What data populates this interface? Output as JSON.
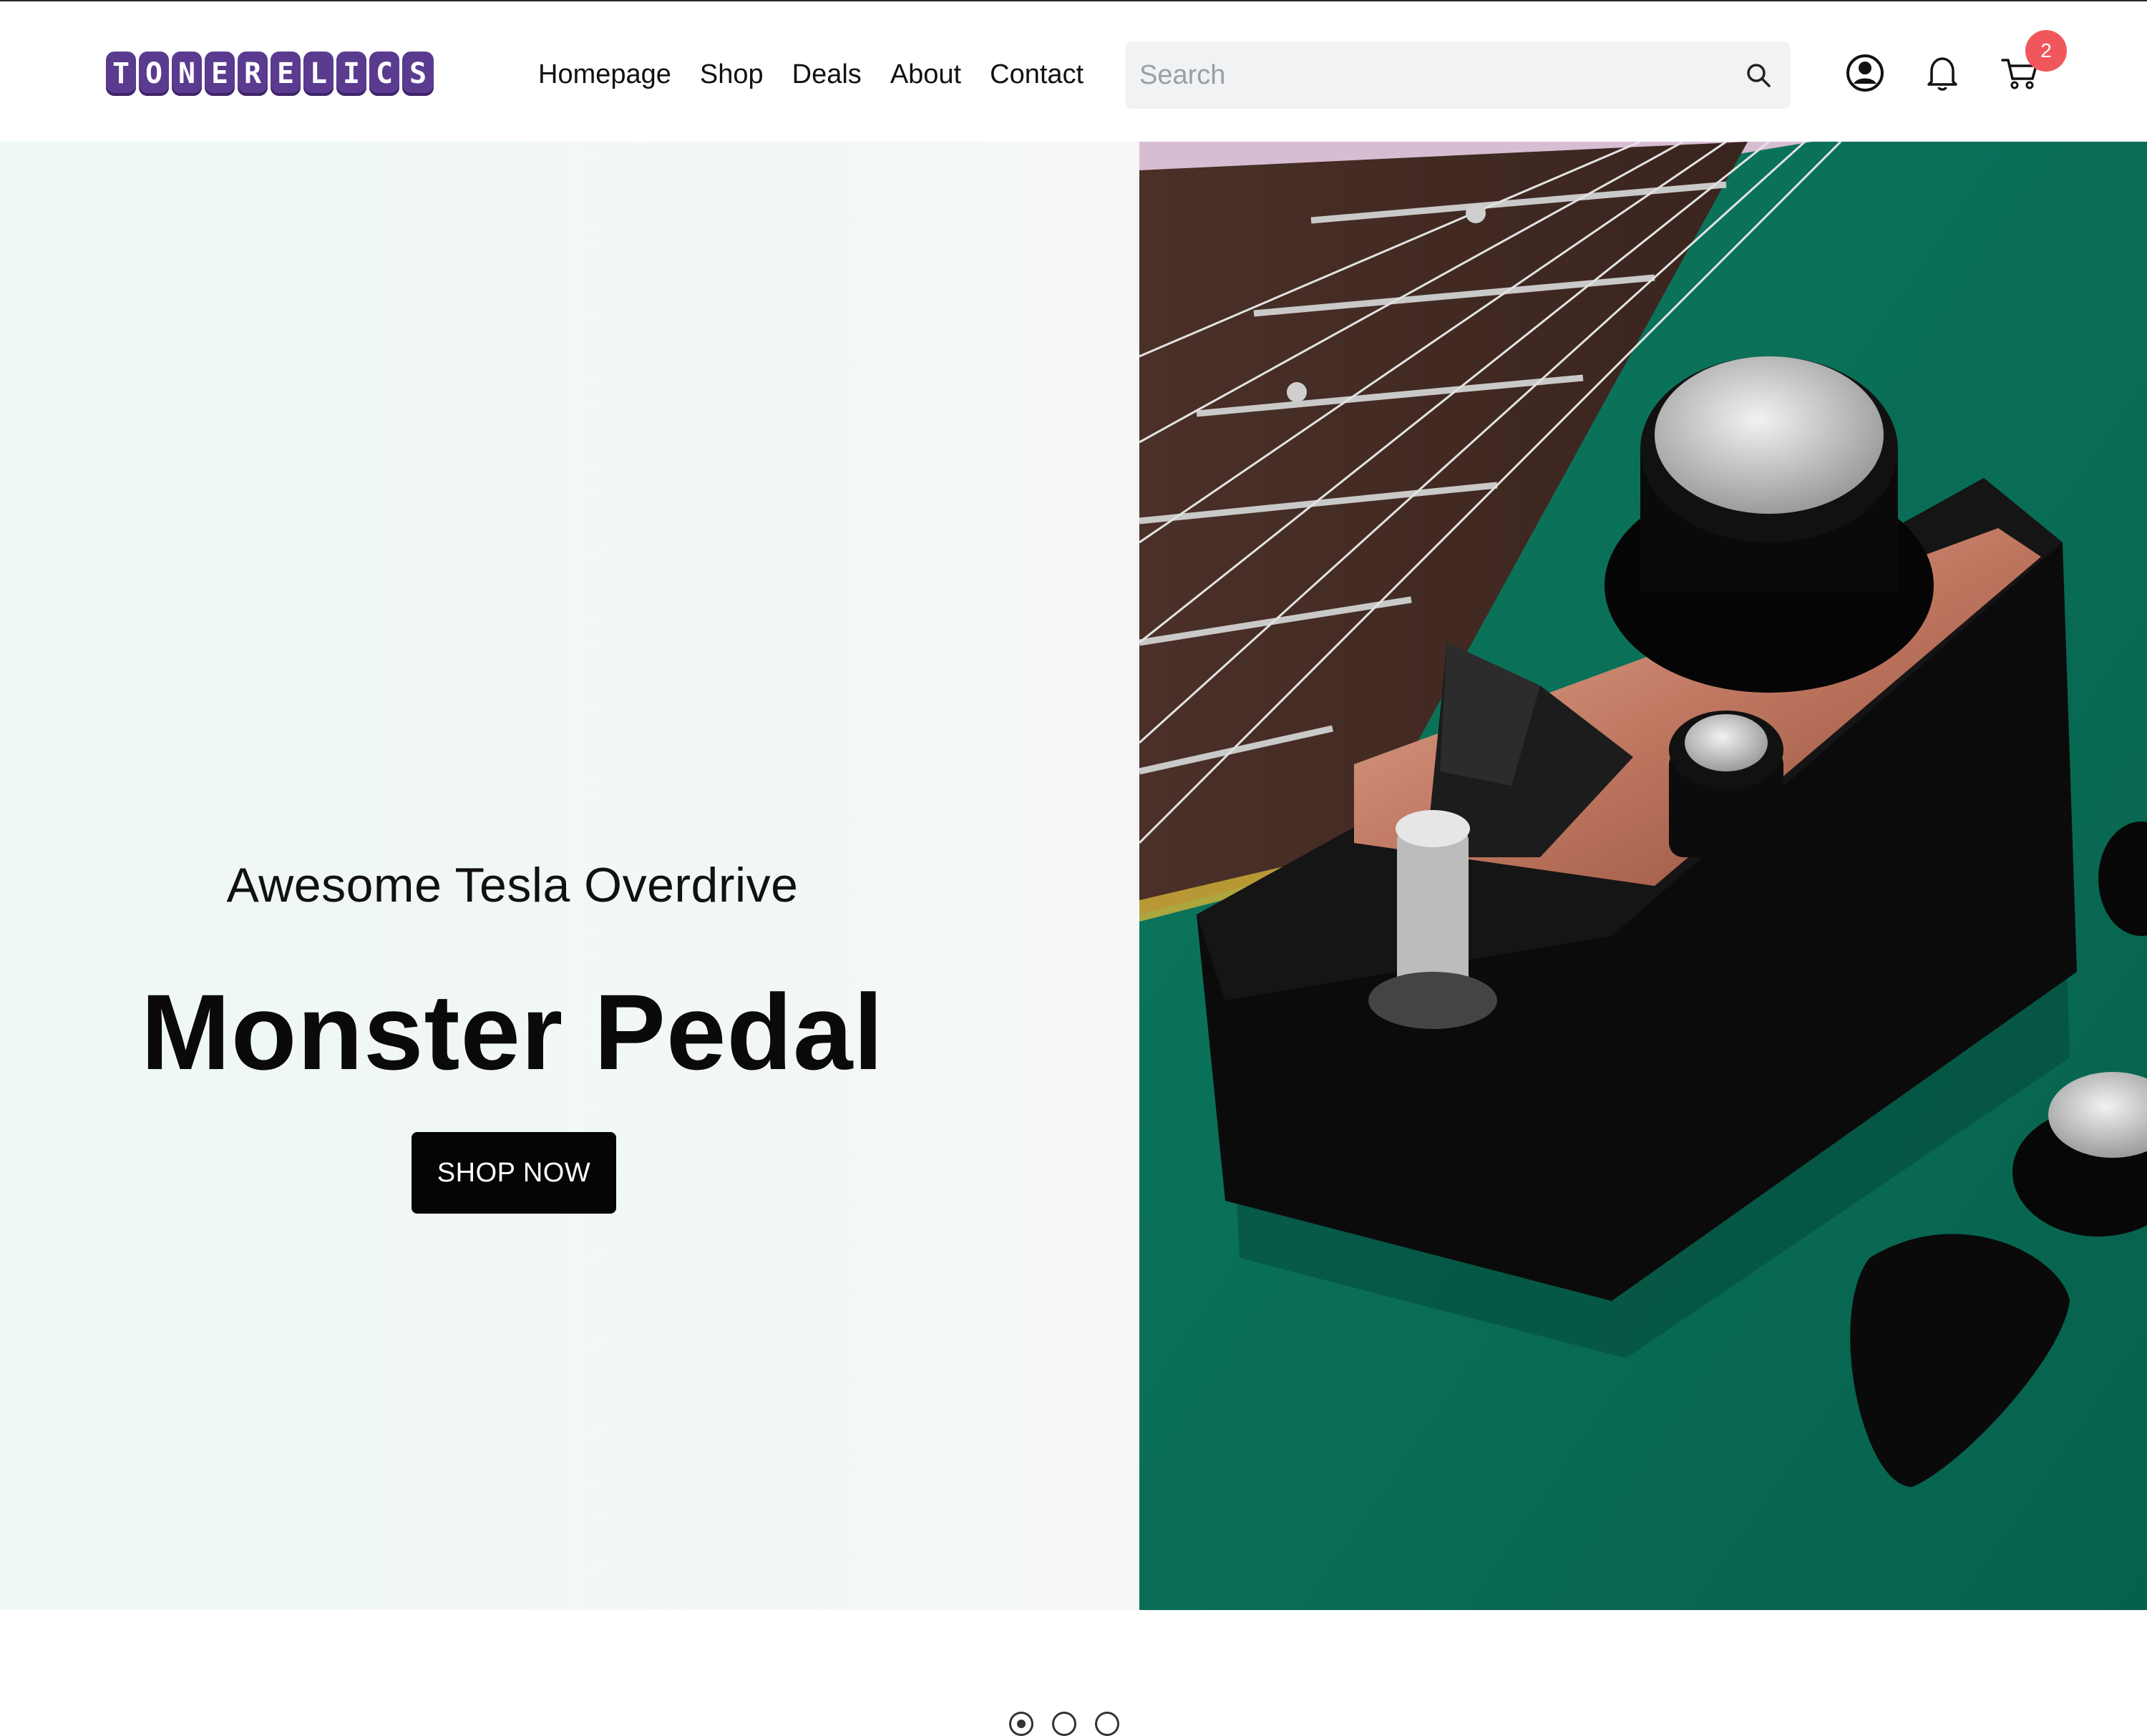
{
  "header": {
    "logo_text": "TONERELICS",
    "nav": [
      "Homepage",
      "Shop",
      "Deals",
      "About",
      "Contact"
    ],
    "search": {
      "placeholder": "Search"
    },
    "cart_count": "2"
  },
  "hero": {
    "kicker": "Awesome Tesla Overdrive",
    "headline": "Monster Pedal",
    "cta_label": "SHOP NOW",
    "slides_total": 3,
    "active_slide": 1
  },
  "colors": {
    "brand": "#5a3b8f",
    "badge": "#f0575c",
    "cta": "#050505",
    "hero_bg": "#eff8f3",
    "photo_bg": "#0b7a5f"
  },
  "icons": [
    "search-icon",
    "user-icon",
    "bell-icon",
    "cart-icon"
  ]
}
